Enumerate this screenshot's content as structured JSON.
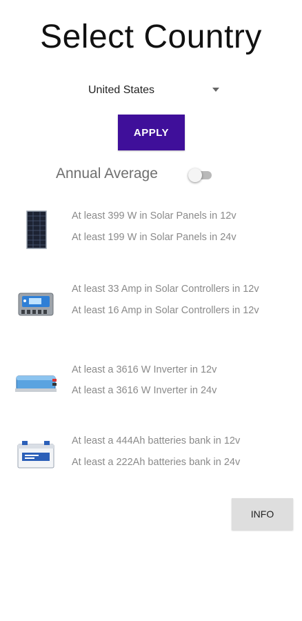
{
  "header": {
    "title": "Select Country"
  },
  "country_select": {
    "selected": "United States"
  },
  "apply_button": {
    "label": "APPLY",
    "color": "#3f0f9a"
  },
  "annual_average": {
    "label": "Annual Average",
    "enabled": false
  },
  "results": [
    {
      "icon": "solar-panel-icon",
      "lines": [
        "At least 399 W in Solar Panels in 12v",
        "At least 199 W in Solar Panels in 24v"
      ]
    },
    {
      "icon": "solar-controller-icon",
      "lines": [
        "At least 33 Amp in Solar Controllers in 12v",
        "At least 16 Amp in Solar Controllers in 12v"
      ]
    },
    {
      "icon": "inverter-icon",
      "lines": [
        "At least a 3616 W Inverter in 12v",
        "At least a 3616 W Inverter in 24v"
      ]
    },
    {
      "icon": "battery-bank-icon",
      "lines": [
        "At least a 444Ah batteries bank in 12v",
        "At least a 222Ah batteries bank in 24v"
      ]
    }
  ],
  "info_button": {
    "label": "INFO"
  }
}
